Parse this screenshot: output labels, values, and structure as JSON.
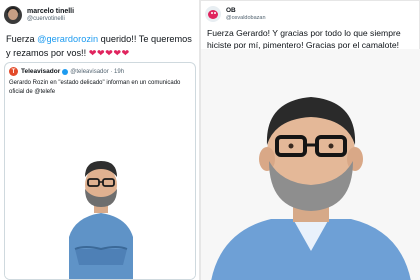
{
  "left_tweet": {
    "author_name": "marcelo tinelli",
    "author_handle": "@cuervotinelli",
    "text_prefix": "Fuerza ",
    "mention": "@gerardorozin",
    "text_suffix": " querido!! Te queremos y rezamos por vos!! ",
    "hearts": "❤❤❤❤❤",
    "quote": {
      "avatar_letter": "T",
      "author_name": "Teleavisador",
      "author_handle": "@teleavisador · 19h",
      "body": "Gerardo Rozín en \"estado delicado\" informan en un comunicado oficial de @telefe",
      "photo_icon": "person-photo"
    }
  },
  "right_tweet": {
    "author_name": "OB",
    "author_handle": "@osvaldobazan",
    "text": "Fuerza Gerardo! Y gracias por todo lo que siempre hiciste por mí, pimentero! Gracias por el camalote!",
    "photo_icon": "person-portrait"
  },
  "colors": {
    "link": "#1d9bf0",
    "heart": "#e0245e",
    "border": "#cfd9de"
  }
}
